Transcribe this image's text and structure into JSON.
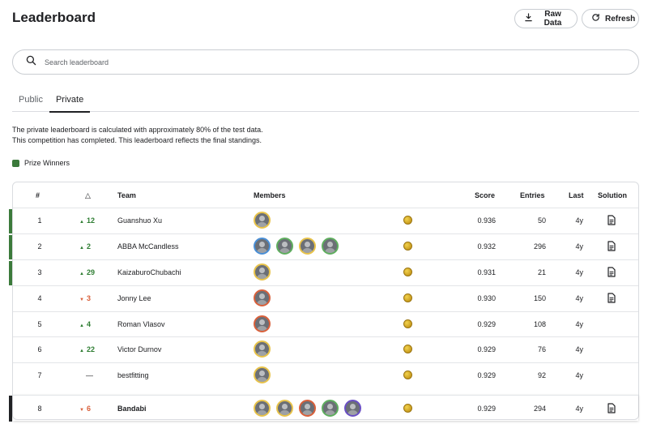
{
  "page": {
    "title": "Leaderboard"
  },
  "toolbar": {
    "raw_data_label": "Raw Data",
    "refresh_label": "Refresh"
  },
  "search": {
    "placeholder": "Search leaderboard",
    "value": ""
  },
  "tabs": [
    {
      "label": "Public",
      "active": false
    },
    {
      "label": "Private",
      "active": true
    }
  ],
  "description": {
    "line1": "The private leaderboard is calculated with approximately 80% of the test data.",
    "line2": "This competition has completed. This leaderboard reflects the final standings."
  },
  "legend": {
    "label": "Prize Winners",
    "color": "#3b7a3b"
  },
  "table": {
    "headers": {
      "rank": "#",
      "delta": "△",
      "team": "Team",
      "members": "Members",
      "score": "Score",
      "entries": "Entries",
      "last": "Last",
      "solution": "Solution"
    },
    "rows": [
      {
        "rank": "1",
        "delta": "12",
        "delta_dir": "up",
        "team": "Guanshuo Xu",
        "members": 1,
        "member_rings": [
          "#e8c34a"
        ],
        "score": "0.936",
        "entries": "50",
        "last": "4y",
        "solution": true,
        "prize": true
      },
      {
        "rank": "2",
        "delta": "2",
        "delta_dir": "up",
        "team": "ABBA McCandless",
        "members": 4,
        "member_rings": [
          "#4a8fd6",
          "#5fae5f",
          "#e8c34a",
          "#5fae5f"
        ],
        "score": "0.932",
        "entries": "296",
        "last": "4y",
        "solution": true,
        "prize": true
      },
      {
        "rank": "3",
        "delta": "29",
        "delta_dir": "up",
        "team": "KaizaburoChubachi",
        "members": 1,
        "member_rings": [
          "#e8c34a"
        ],
        "score": "0.931",
        "entries": "21",
        "last": "4y",
        "solution": true,
        "prize": true
      },
      {
        "rank": "4",
        "delta": "3",
        "delta_dir": "down",
        "team": "Jonny Lee",
        "members": 1,
        "member_rings": [
          "#d9603b"
        ],
        "score": "0.930",
        "entries": "150",
        "last": "4y",
        "solution": true,
        "prize": false
      },
      {
        "rank": "5",
        "delta": "4",
        "delta_dir": "up",
        "team": "Roman Vlasov",
        "members": 1,
        "member_rings": [
          "#d9603b"
        ],
        "score": "0.929",
        "entries": "108",
        "last": "4y",
        "solution": false,
        "prize": false
      },
      {
        "rank": "6",
        "delta": "22",
        "delta_dir": "up",
        "team": "Victor Durnov",
        "members": 1,
        "member_rings": [
          "#e8c34a"
        ],
        "score": "0.929",
        "entries": "76",
        "last": "4y",
        "solution": false,
        "prize": false
      },
      {
        "rank": "7",
        "delta": "—",
        "delta_dir": "none",
        "team": "bestfitting",
        "members": 1,
        "member_rings": [
          "#e8c34a"
        ],
        "score": "0.929",
        "entries": "92",
        "last": "4y",
        "solution": false,
        "prize": false
      },
      {
        "rank": "8",
        "delta": "6",
        "delta_dir": "down",
        "team": "Bandabi",
        "members": 5,
        "member_rings": [
          "#e8c34a",
          "#e8c34a",
          "#d9603b",
          "#5fae5f",
          "#6a4fc4"
        ],
        "score": "0.929",
        "entries": "294",
        "last": "4y",
        "solution": true,
        "prize": false,
        "highlight": true
      }
    ]
  },
  "colors": {
    "prize": "#3b7a3b",
    "up": "#2e7d32",
    "down": "#d9603b",
    "self": "#202124"
  },
  "icons": {
    "raw_data": "download-icon",
    "refresh": "refresh-icon",
    "search": "search-icon",
    "solution": "document-icon",
    "medal": "gold-medal-icon"
  }
}
